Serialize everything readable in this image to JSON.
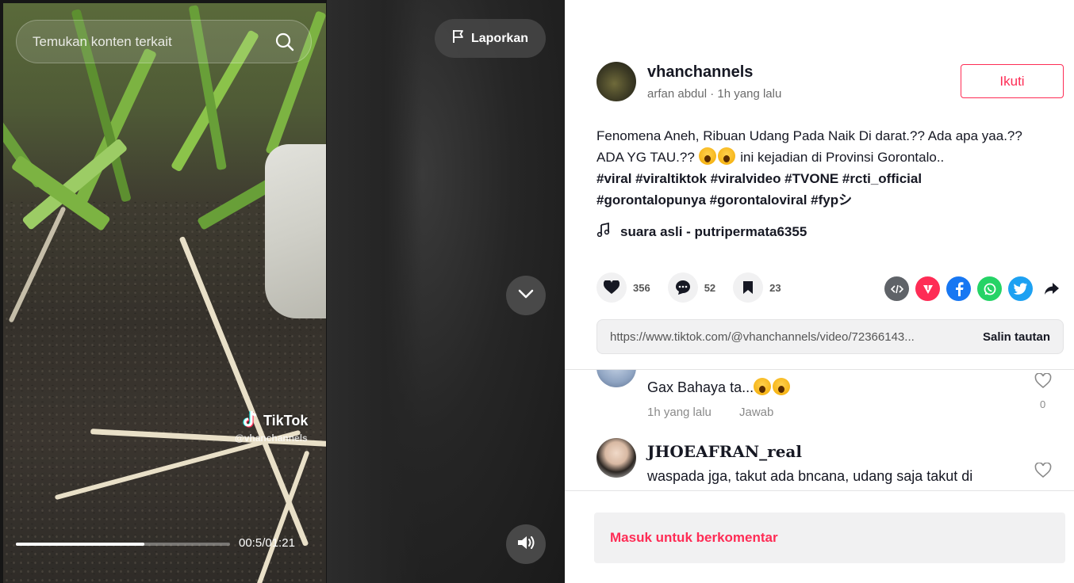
{
  "search": {
    "placeholder": "Temukan konten terkait"
  },
  "player": {
    "report_label": "Laporkan",
    "current_time": "00:5",
    "total_time": "/01:21",
    "progress": 0.6,
    "watermark_brand": "TikTok",
    "watermark_user": "@vhanchannels"
  },
  "author": {
    "username": "vhanchannels",
    "display_name": "arfan abdul",
    "separator": " · ",
    "posted": "1h yang lalu",
    "follow_label": "Ikuti"
  },
  "post": {
    "caption_part1": "Fenomena Aneh, Ribuan Udang Pada Naik Di darat.?? Ada apa yaa.?? ADA YG TAU.?? ",
    "caption_part2": " ini kejadian di Provinsi Gorontalo..",
    "hashtags_line1": "#viral #viraltiktok #viralvideo #TVONE #rcti_official",
    "hashtags_line2": "#gorontalopunya #gorontaloviral #fypシ",
    "music": "suara asli - putripermata6355"
  },
  "stats": {
    "likes": "356",
    "comments": "52",
    "saves": "23"
  },
  "share": {
    "colors": {
      "embed": "#5f6368",
      "send": "#fe2c55",
      "facebook": "#1877f2",
      "whatsapp": "#25d366",
      "twitter": "#1da1f2"
    },
    "link": "https://www.tiktok.com/@vhanchannels/video/72366143...",
    "copy_label": "Salin tautan"
  },
  "comments": [
    {
      "text": "Gax Bahaya ta...",
      "time": "1h yang lalu",
      "reply": "Jawab",
      "likes": "0"
    },
    {
      "name": "JHOEAFRAN_real",
      "text": "waspada jga, takut ada bncana, udang saja takut di"
    }
  ],
  "comment_input": {
    "label": "Masuk untuk berkomentar"
  },
  "colors": {
    "accent": "#fe2c55"
  }
}
